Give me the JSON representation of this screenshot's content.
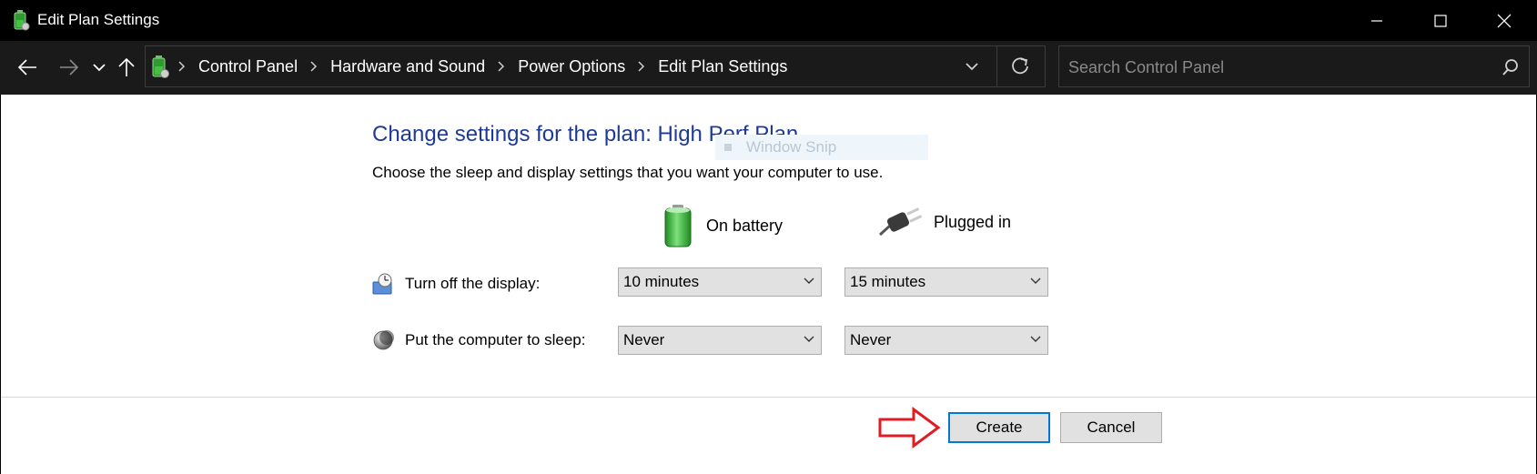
{
  "window": {
    "title": "Edit Plan Settings",
    "icon": "battery-plan-icon"
  },
  "address_bar": {
    "breadcrumbs": [
      "Control Panel",
      "Hardware and Sound",
      "Power Options",
      "Edit Plan Settings"
    ],
    "search_placeholder": "Search Control Panel"
  },
  "content": {
    "heading": "Change settings for the plan: High Perf Plan",
    "ghost_tooltip": "Window Snip",
    "description": "Choose the sleep and display settings that you want your computer to use.",
    "columns": {
      "battery": "On battery",
      "plugged": "Plugged in"
    },
    "rows": [
      {
        "label": "Turn off the display:",
        "battery": "10 minutes",
        "plugged": "15 minutes",
        "icon": "display-clock-icon"
      },
      {
        "label": "Put the computer to sleep:",
        "battery": "Never",
        "plugged": "Never",
        "icon": "moon-sleep-icon"
      }
    ]
  },
  "footer": {
    "create_label": "Create",
    "cancel_label": "Cancel"
  },
  "colors": {
    "heading": "#1e3a96",
    "accent": "#0078d7",
    "annotation_arrow": "#e01b24",
    "titlebar": "#000000"
  }
}
